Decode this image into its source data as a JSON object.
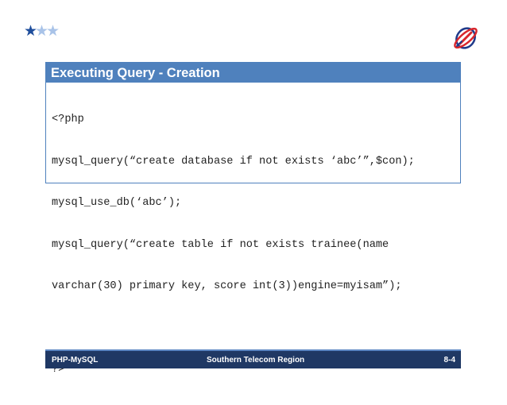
{
  "slide": {
    "title": "Executing Query - Creation",
    "code_lines": [
      "<?php",
      "mysql_query(“create database if not exists ‘abc’”,$con);",
      "mysql_use_db(‘abc’);",
      "mysql_query(“create table if not exists trainee(name",
      "varchar(30) primary key, score int(3))engine=myisam”);",
      "",
      "?>"
    ]
  },
  "footer": {
    "left": "PHP-MySQL",
    "center": "Southern Telecom Region",
    "right": "8-4"
  },
  "colors": {
    "accent": "#4f81bd",
    "footer_bg": "#1f3864",
    "star_dark": "#1f4e9c",
    "star_light": "#a9c3e8"
  }
}
